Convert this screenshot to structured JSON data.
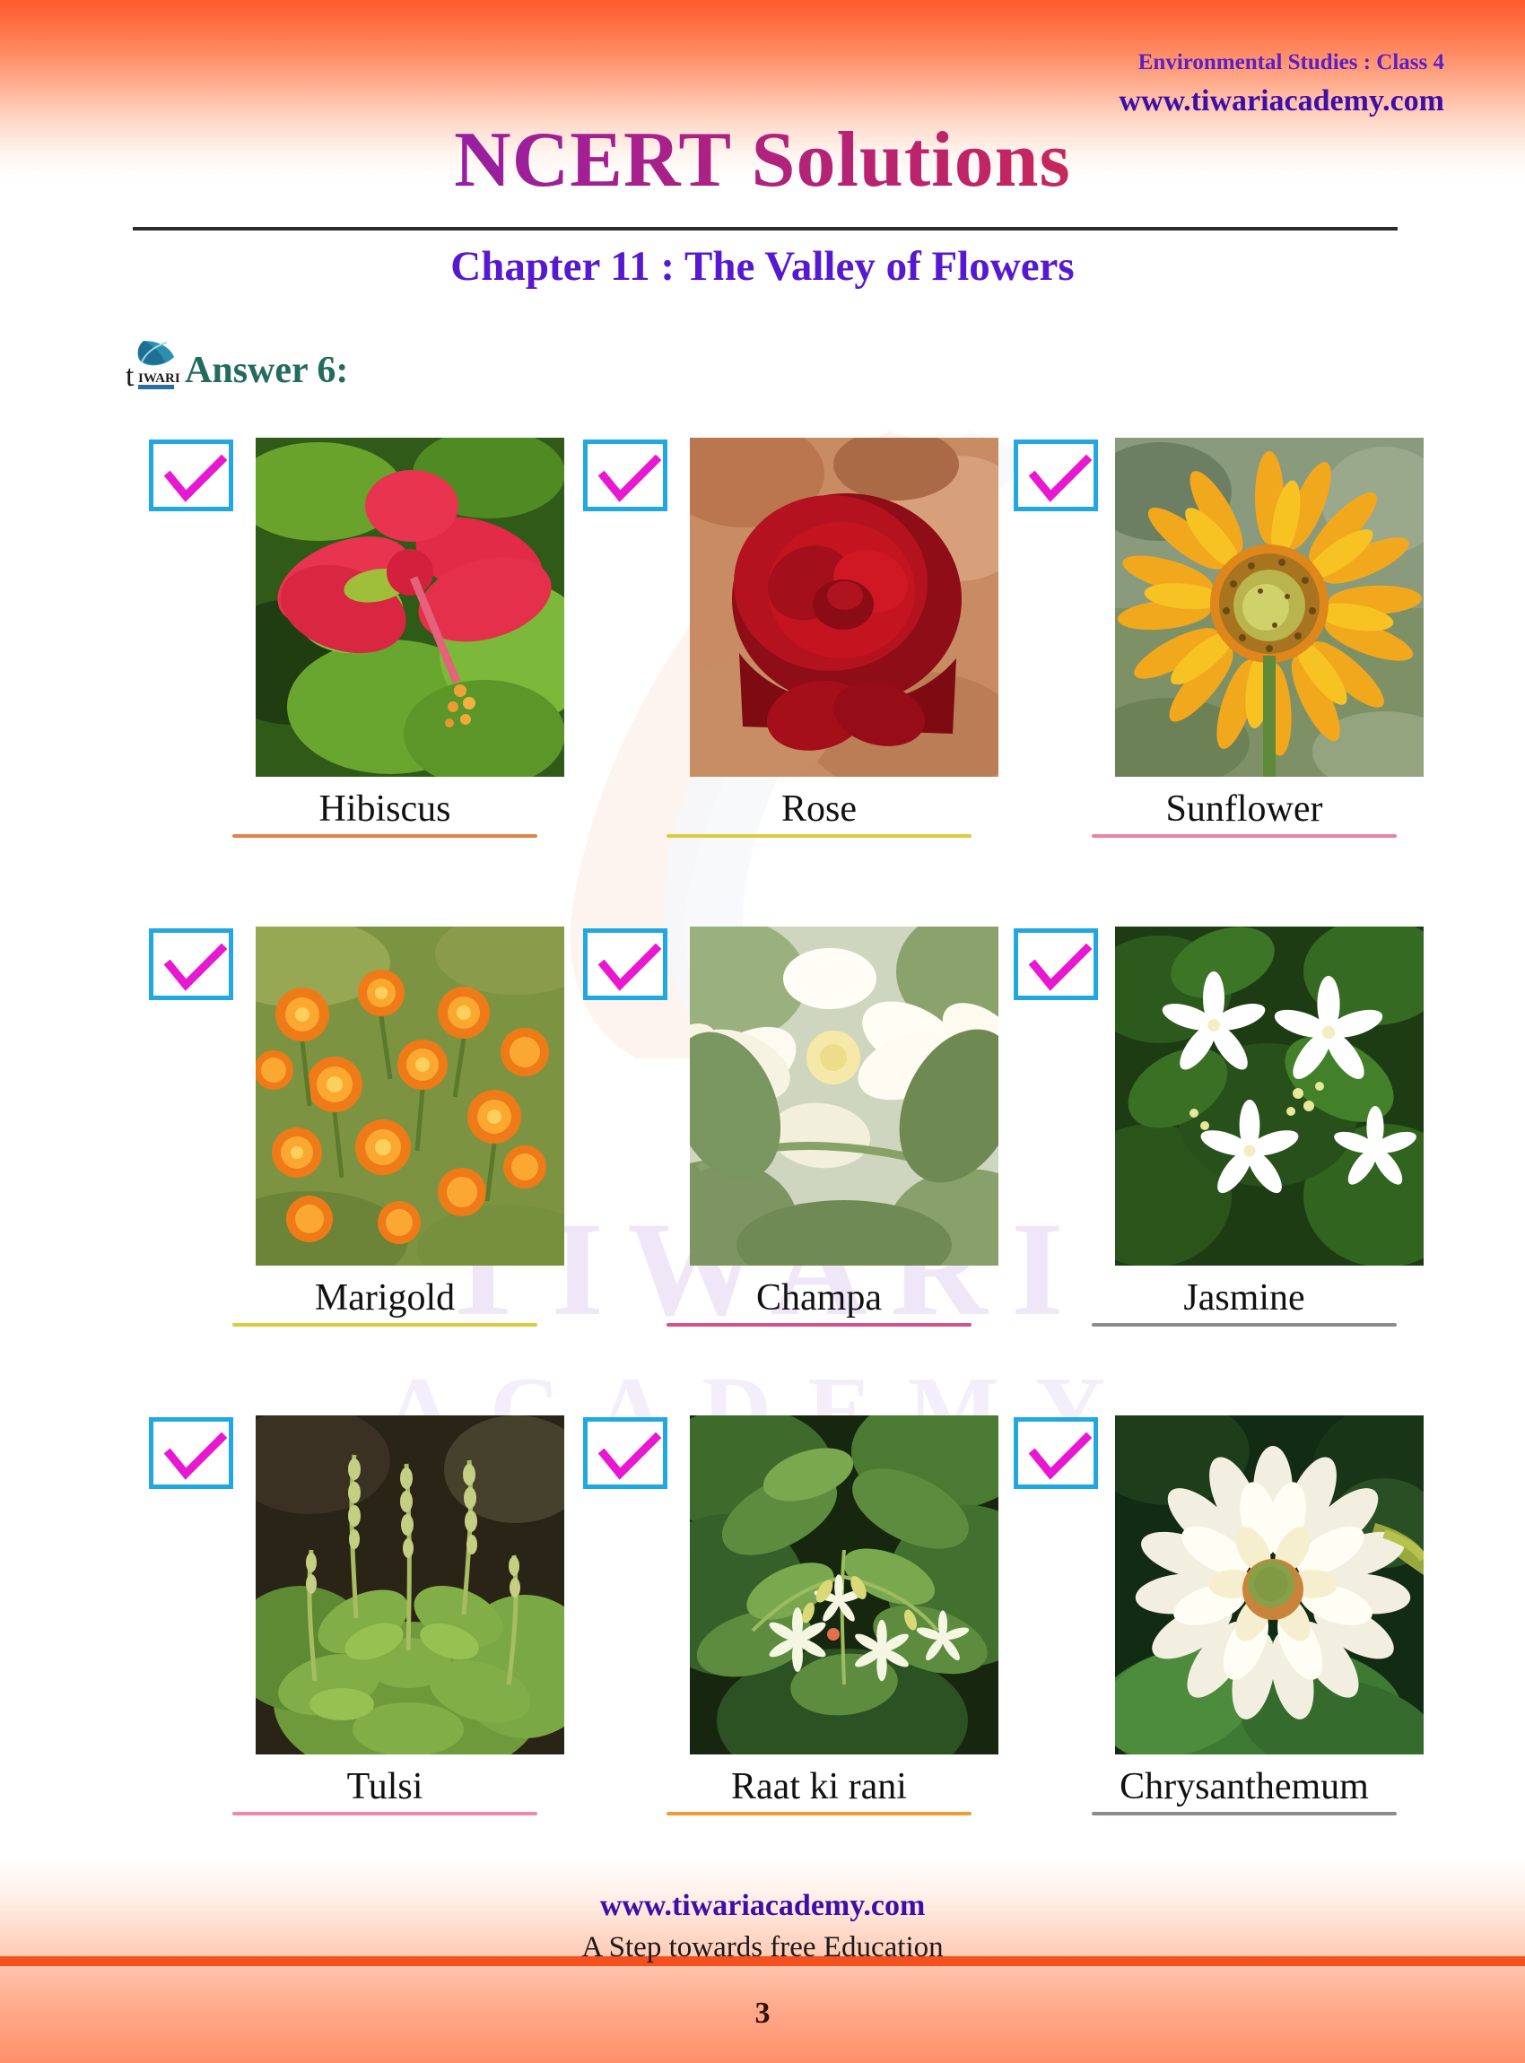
{
  "header": {
    "subject_line": "Environmental Studies : Class 4",
    "site_url": "www.tiwariacademy.com",
    "main_title": "NCERT Solutions",
    "chapter_title": "Chapter 11 : The Valley of Flowers"
  },
  "answer": {
    "heading": "Answer 6:",
    "logo_text": "tIWARI"
  },
  "watermark": {
    "line1": "TIWARI",
    "line2": "ACADEMY"
  },
  "colors": {
    "checkbox_border": "#22a8e0",
    "checkmark": "#e818d2",
    "heading_green": "#236b5e",
    "link_purple": "#3d0fa8",
    "chapter_purple": "#5719d0",
    "band_orange": "#ff5a2d",
    "footer_bar": "#f4511e"
  },
  "grid": {
    "rows": [
      [
        {
          "label": "Hibiscus",
          "checked": true,
          "rule_color": "#e2834a",
          "art": "hibiscus"
        },
        {
          "label": "Rose",
          "checked": true,
          "rule_color": "#dccb3e",
          "art": "rose"
        },
        {
          "label": "Sunflower",
          "checked": true,
          "rule_color": "#e8849f",
          "art": "sunflower"
        }
      ],
      [
        {
          "label": "Marigold",
          "checked": true,
          "rule_color": "#dccb3e",
          "art": "marigold"
        },
        {
          "label": "Champa",
          "checked": true,
          "rule_color": "#d4518c",
          "art": "champa"
        },
        {
          "label": "Jasmine",
          "checked": true,
          "rule_color": "#8b8b94",
          "art": "jasmine"
        }
      ],
      [
        {
          "label": "Tulsi",
          "checked": true,
          "rule_color": "#ef8aa6",
          "art": "tulsi"
        },
        {
          "label": "Raat ki rani",
          "checked": true,
          "rule_color": "#ef9a3c",
          "art": "raatkirani"
        },
        {
          "label": "Chrysanthemum",
          "checked": true,
          "rule_color": "#8b8b94",
          "art": "chrysanthemum"
        }
      ]
    ]
  },
  "footer": {
    "url": "www.tiwariacademy.com",
    "tagline": "A Step towards free Education",
    "page_number": "3"
  }
}
